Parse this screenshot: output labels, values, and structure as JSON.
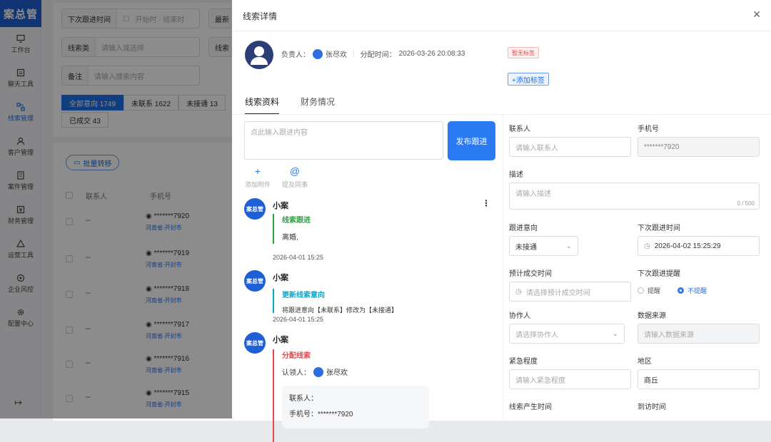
{
  "logo": "案总管",
  "sidebar": {
    "items": [
      {
        "label": "工作台",
        "icon": "desktop-icon"
      },
      {
        "label": "聊天工具",
        "icon": "chat-icon"
      },
      {
        "label": "线索管理",
        "icon": "clue-icon",
        "active": true
      },
      {
        "label": "客户管理",
        "icon": "user-icon"
      },
      {
        "label": "案件管理",
        "icon": "case-icon"
      },
      {
        "label": "财务管理",
        "icon": "finance-icon"
      },
      {
        "label": "运营工具",
        "icon": "ops-icon"
      },
      {
        "label": "企业风控",
        "icon": "shield-icon"
      },
      {
        "label": "配置中心",
        "icon": "gear-icon"
      }
    ],
    "logout": "↦"
  },
  "filters": {
    "next_follow_label": "下次跟进时间",
    "next_follow_placeholder": "开始时 - 结束时",
    "latest_label": "最新",
    "clue_type_label": "线索类",
    "clue_type_placeholder": "请输入或选择",
    "clue2_label": "线索",
    "remark_label": "备注",
    "remark_placeholder": "请输入搜索内容"
  },
  "status_tabs": [
    {
      "label": "全部意向 1749",
      "active": true
    },
    {
      "label": "未联系 1622"
    },
    {
      "label": "未接通 13"
    }
  ],
  "deal_tab": "已成交 43",
  "batch_transfer": "批量转移",
  "table": {
    "headers": [
      "联系人",
      "手机号"
    ],
    "rows": [
      {
        "name": "--",
        "phone": "*******7920",
        "region": "河南省-开封市"
      },
      {
        "name": "--",
        "phone": "*******7919",
        "region": "河南省-开封市"
      },
      {
        "name": "--",
        "phone": "*******7918",
        "region": "河南省-开封市"
      },
      {
        "name": "--",
        "phone": "*******7917",
        "region": "河南省-开封市"
      },
      {
        "name": "--",
        "phone": "*******7916",
        "region": "河南省-开封市"
      },
      {
        "name": "--",
        "phone": "*******7915",
        "region": "河南省-开封市"
      }
    ]
  },
  "drawer": {
    "title": "线索详情",
    "owner_label": "负责人：",
    "owner": "张尽欢",
    "assign_label": "分配时间：",
    "assign_time": "2026-03-26 20:08:33",
    "tag_none": "暂无标签",
    "add_tag": "+添加标签",
    "tabs": [
      {
        "label": "线索资料",
        "active": true
      },
      {
        "label": "财务情况"
      }
    ],
    "follow_placeholder": "点此输入跟进内容",
    "publish": "发布跟进",
    "add_attachment": "添加附件",
    "mention": "提及同事",
    "timeline": [
      {
        "author": "小案",
        "title": "线索跟进",
        "title_color": "#2ea043",
        "body": "离婚,",
        "time": "2026-04-01 15:25",
        "bar": "#2ea043"
      },
      {
        "author": "小案",
        "title": "更新线索意向",
        "title_color": "#0ea5c6",
        "body": "将跟进意向【未联系】修改为【未接通】",
        "time": "2026-04-01 15:25",
        "bar": "#0ea5c6"
      },
      {
        "author": "小案",
        "title": "分配线索",
        "title_color": "#e5484d",
        "claim_label": "认领人：",
        "claimer": "张尽欢",
        "contact_label": "联系人：",
        "phone_label": "手机号：",
        "phone": "*******7920",
        "bar": "#e5484d"
      }
    ],
    "form": {
      "contact_label": "联系人",
      "contact_placeholder": "请输入联系人",
      "phone_label": "手机号",
      "phone_value": "*******7920",
      "desc_label": "描述",
      "desc_placeholder": "请输入描述",
      "desc_count": "0 / 500",
      "intent_label": "跟进意向",
      "intent_value": "未接通",
      "next_label": "下次跟进时间",
      "next_value": "2026-04-02 15:25:29",
      "deal_time_label": "预计成交时间",
      "deal_time_placeholder": "请选择预计成交时间",
      "remind_label": "下次跟进提醒",
      "remind_yes": "提醒",
      "remind_no": "不提醒",
      "partner_label": "协作人",
      "partner_placeholder": "请选择协作人",
      "source_label": "数据来源",
      "source_placeholder": "请输入数据来源",
      "urgency_label": "紧急程度",
      "urgency_placeholder": "请输入紧急程度",
      "region_label": "地区",
      "region_value": "商丘",
      "created_label": "线索产生时间",
      "visit_label": "到访时间"
    }
  }
}
